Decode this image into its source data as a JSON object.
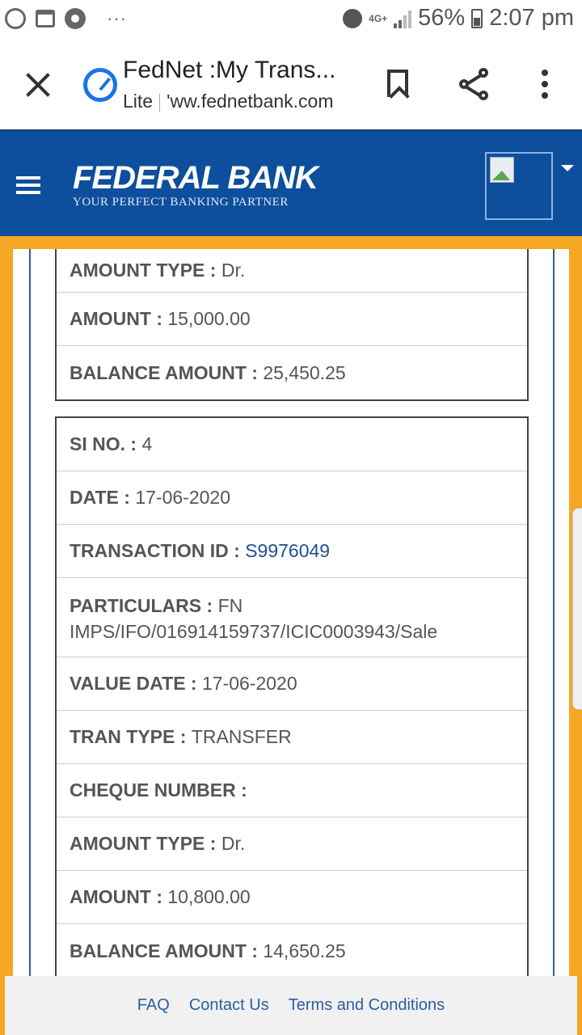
{
  "status_bar": {
    "network": "4G+",
    "battery": "56%",
    "time": "2:07 pm",
    "overflow": "···"
  },
  "browser": {
    "title": "FedNet :My Trans...",
    "mode": "Lite",
    "url": "'ww.fednetbank.com"
  },
  "bank": {
    "name": "FEDERAL BANK",
    "tagline": "YOUR PERFECT BANKING PARTNER",
    "brand_color": "#0d4f9c",
    "accent_color": "#f5a623"
  },
  "card_prev": {
    "rows": [
      {
        "label": "AMOUNT TYPE : ",
        "value": "Dr."
      },
      {
        "label": "AMOUNT : ",
        "value": "15,000.00"
      },
      {
        "label": "BALANCE AMOUNT : ",
        "value": "25,450.25"
      }
    ]
  },
  "card_4": {
    "rows": [
      {
        "label": "SI NO. : ",
        "value": "4"
      },
      {
        "label": "DATE : ",
        "value": "17-06-2020"
      },
      {
        "label": "TRANSACTION ID : ",
        "value": "S9976049"
      },
      {
        "label": "PARTICULARS : ",
        "value": "FN IMPS/IFO/016914159737/ICIC0003943/Sale"
      },
      {
        "label": "VALUE DATE : ",
        "value": "17-06-2020"
      },
      {
        "label": "TRAN TYPE : ",
        "value": "TRANSFER"
      },
      {
        "label": "CHEQUE NUMBER : ",
        "value": ""
      },
      {
        "label": "AMOUNT TYPE : ",
        "value": "Dr."
      },
      {
        "label": "AMOUNT : ",
        "value": "10,800.00"
      },
      {
        "label": "BALANCE AMOUNT : ",
        "value": "14,650.25"
      }
    ]
  },
  "footer": {
    "faq": "FAQ",
    "contact": "Contact Us",
    "terms": "Terms and Conditions"
  }
}
